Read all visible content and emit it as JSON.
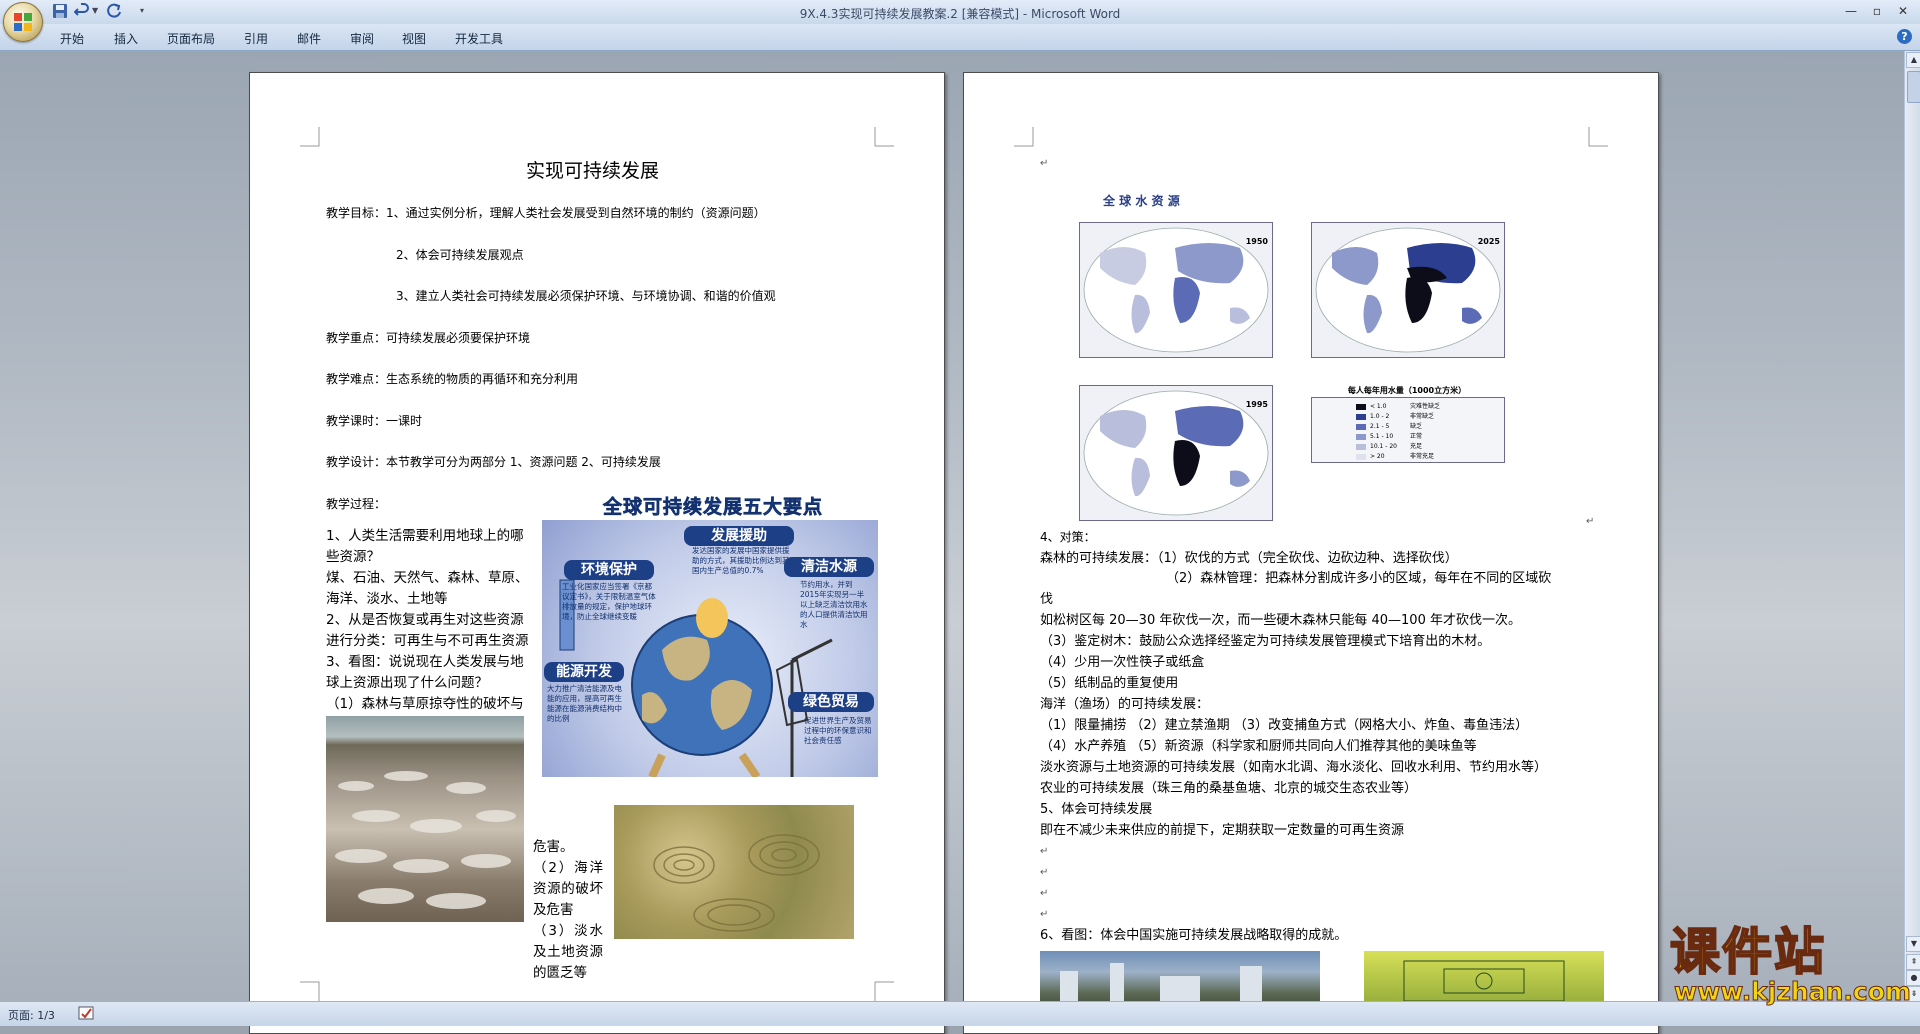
{
  "window": {
    "title": "9X.4.3实现可持续发展教案.2 [兼容模式] - Microsoft Word"
  },
  "ribbon": {
    "tabs": [
      "开始",
      "插入",
      "页面布局",
      "引用",
      "邮件",
      "审阅",
      "视图",
      "开发工具"
    ]
  },
  "status": {
    "page": "页面: 1/3"
  },
  "watermark": {
    "logo": "课件站",
    "url": "www.kjzhan.com"
  },
  "page1": {
    "title": "实现可持续发展",
    "lines": [
      "教学目标：1、通过实例分析，理解人类社会发展受到自然环境的制约（资源问题）",
      "2、体会可持续发展观点",
      "3、建立人类社会可持续发展必须保护环境、与环境协调、和谐的价值观",
      "教学重点：可持续发展必须要保护环境",
      "教学难点：生态系统的物质的再循环和充分利用",
      "教学课时：一课时",
      "教学设计：本节教学可分为两部分 1、资源问题   2、可持续发展",
      "教学过程："
    ],
    "body": [
      "1、人类生活需要利用地球上的哪些资源？",
      "煤、石油、天然气、森林、草原、海洋、淡水、土地等",
      "2、从是否恢复或再生对这些资源进行分类：可再生与不可再生资源",
      "3、看图：说说现在人类发展与地球上资源出现了什么问题？",
      "（1）森林与草原掠夺性的破坏与"
    ],
    "after_img": [
      "危害。",
      "（2）海洋资源的破坏及危害",
      "（3）淡水及土地资源的匮乏等"
    ],
    "poster": {
      "title": "全球可持续发展五大要点",
      "items": [
        "发展援助",
        "环境保护",
        "清洁水源",
        "能源开发",
        "绿色贸易"
      ],
      "notes": {
        "aid": "发达国家的发展中国家提供援助的方式，其援助比例达到其国内生产总值的0.7%",
        "env": "工业化国家应当签署《京都议定书》，关于限制温室气体排放量的规定，保护地球环境，防止全球继续变暖",
        "water": "节约用水，并到2015年实现另一半以上缺乏清洁饮用水的人口提供清洁饮用水",
        "energy": "大力推广清洁能源及电能的应用，提高可再生能源在能源消费结构中的比例",
        "trade": "促进世界生产及贸易过程中的环保意识和社会责任感"
      }
    }
  },
  "page2": {
    "map": {
      "title": "全 球 水 资 源",
      "years": [
        "1950",
        "2025",
        "1995"
      ],
      "legend_title": "每人每年用水量（1000立方米）",
      "legend": [
        {
          "range": "< 1.0",
          "label": "灾难性缺乏",
          "color": "#0d0d1a"
        },
        {
          "range": "1.0 - 2",
          "label": "非常缺乏",
          "color": "#2b3e8f"
        },
        {
          "range": "2.1 - 5",
          "label": "缺乏",
          "color": "#5b6bb5"
        },
        {
          "range": "5.1 - 10",
          "label": "正常",
          "color": "#8e99cb"
        },
        {
          "range": "10.1 - 20",
          "label": "充足",
          "color": "#b8bedb"
        },
        {
          "range": "> 20",
          "label": "非常充足",
          "color": "#dfe2ee"
        }
      ]
    },
    "lines": [
      "4、对策：",
      "森林的可持续发展：（1）砍伐的方式（完全砍伐、边砍边种、选择砍伐）",
      "（2）森林管理：把森林分割成许多小的区域，每年在不同的区域砍",
      "伐",
      "如松树区每 20—30 年砍伐一次，而一些硬木森林只能每 40—100 年才砍伐一次。",
      "（3）鉴定树木：鼓励公众选择经鉴定为可持续发展管理模式下培育出的木材。",
      "（4）少用一次性筷子或纸盒",
      "（5）纸制品的重复使用",
      "海洋（渔场）的可持续发展：",
      "（1）限量捕捞   （2）建立禁渔期    （3）改变捕鱼方式（网格大小、炸鱼、毒鱼违法）",
      "（4）水产养殖   （5）新资源（科学家和厨师共同向人们推荐其他的美味鱼等",
      "淡水资源与土地资源的可持续发展（如南水北调、海水淡化、回收水利用、节约用水等）",
      "农业的可持续发展（珠三角的桑基鱼塘、北京的城交生态农业等）",
      "5、体会可持续发展",
      "即在不减少未来供应的前提下，定期获取一定数量的可再生资源",
      "6、看图：体会中国实施可持续发展战略取得的成就。"
    ]
  }
}
